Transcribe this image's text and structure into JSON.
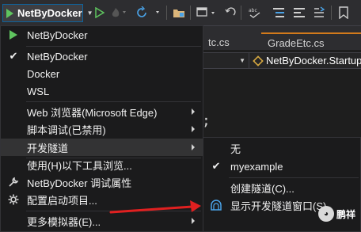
{
  "toolbar": {
    "run_target": "NetByDocker"
  },
  "editor": {
    "tabs": [
      {
        "label": "tc.cs"
      },
      {
        "label": "GradeEtc.cs"
      }
    ],
    "nav_member": "NetByDocker.Startup",
    "code_fragment": ";"
  },
  "main_menu": {
    "items": [
      {
        "label": "NetByDocker",
        "icon": "play-icon"
      },
      {
        "label": "NetByDocker",
        "icon": "checkmark-icon"
      },
      {
        "label": "Docker"
      },
      {
        "label": "WSL"
      },
      {
        "label": "Web 浏览器(Microsoft Edge)",
        "submenu": true
      },
      {
        "label": "脚本调试(已禁用)",
        "submenu": true
      },
      {
        "label": "开发隧道",
        "submenu": true
      },
      {
        "label": "使用(H)以下工具浏览..."
      },
      {
        "label": "NetByDocker 调试属性",
        "icon": "wrench-icon"
      },
      {
        "label": "配置启动项目...",
        "icon": "gear-icon"
      },
      {
        "label": "更多模拟器(E)...",
        "submenu": true
      }
    ]
  },
  "sub_menu": {
    "items": [
      {
        "label": "无"
      },
      {
        "label": "myexample",
        "icon": "checkmark-icon"
      },
      {
        "label": "创建隧道(C)..."
      },
      {
        "label": "显示开发隧道窗口(S)",
        "icon": "tunnel-icon"
      }
    ]
  },
  "watermark": {
    "text": "鹏祥"
  },
  "colors": {
    "accent_play": "#5fc45f",
    "active_tab_border": "#d27a1b",
    "annotation_arrow": "#e02020",
    "menu_bg": "#1b1b1c",
    "menu_highlight": "#333334"
  }
}
